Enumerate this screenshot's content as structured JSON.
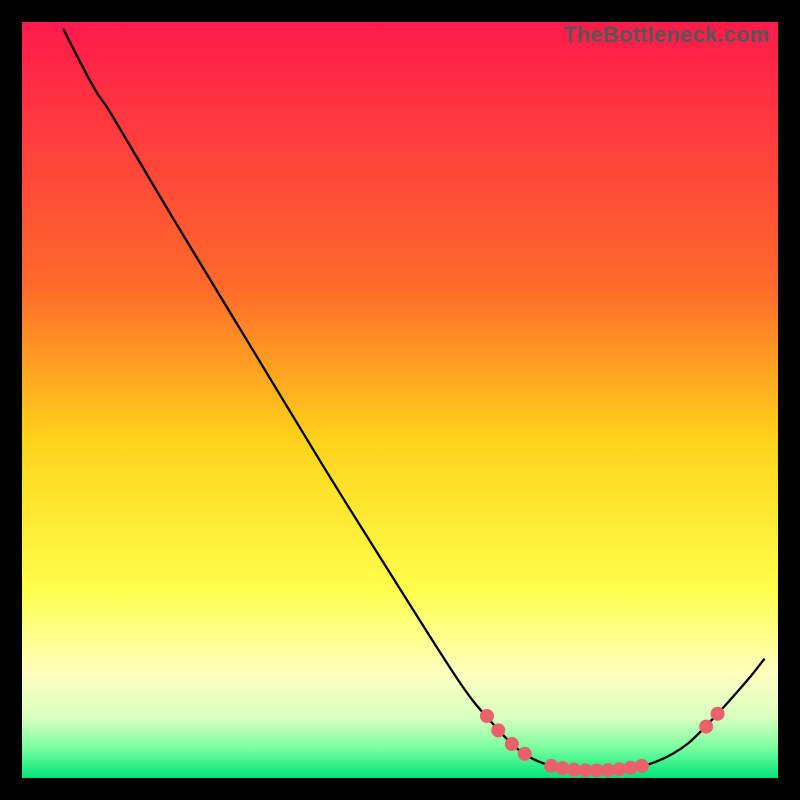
{
  "watermark": "TheBottleneck.com",
  "chart_data": {
    "type": "line",
    "title": "",
    "xlabel": "",
    "ylabel": "",
    "xlim": [
      0,
      100
    ],
    "ylim": [
      0,
      100
    ],
    "gradient_stops": [
      {
        "offset": 0,
        "color": "#ff1a4b"
      },
      {
        "offset": 35,
        "color": "#ff6a2a"
      },
      {
        "offset": 55,
        "color": "#ffd21a"
      },
      {
        "offset": 75,
        "color": "#ffff4a"
      },
      {
        "offset": 86,
        "color": "#ffffbe"
      },
      {
        "offset": 92,
        "color": "#d9ffc0"
      },
      {
        "offset": 96,
        "color": "#7affa0"
      },
      {
        "offset": 100,
        "color": "#00e676"
      }
    ],
    "series": [
      {
        "name": "bottleneck-curve",
        "stroke": "#000000",
        "stroke_width": 2.3,
        "points": [
          {
            "x": 5.5,
            "y": 99.0
          },
          {
            "x": 8.0,
            "y": 94.0
          },
          {
            "x": 10.0,
            "y": 90.5
          },
          {
            "x": 12.0,
            "y": 87.5
          },
          {
            "x": 20.0,
            "y": 74.0
          },
          {
            "x": 30.0,
            "y": 57.5
          },
          {
            "x": 40.0,
            "y": 41.0
          },
          {
            "x": 50.0,
            "y": 25.0
          },
          {
            "x": 58.0,
            "y": 12.5
          },
          {
            "x": 62.0,
            "y": 7.5
          },
          {
            "x": 66.0,
            "y": 3.5
          },
          {
            "x": 70.0,
            "y": 1.6
          },
          {
            "x": 75.0,
            "y": 1.0
          },
          {
            "x": 80.0,
            "y": 1.2
          },
          {
            "x": 84.0,
            "y": 2.2
          },
          {
            "x": 88.0,
            "y": 4.5
          },
          {
            "x": 92.0,
            "y": 8.5
          },
          {
            "x": 96.0,
            "y": 13.0
          },
          {
            "x": 98.0,
            "y": 15.5
          }
        ]
      }
    ],
    "markers": {
      "color": "#e9626b",
      "radius": 7,
      "points": [
        {
          "x": 61.5,
          "y": 8.2
        },
        {
          "x": 63.0,
          "y": 6.3
        },
        {
          "x": 64.8,
          "y": 4.5
        },
        {
          "x": 66.5,
          "y": 3.2
        },
        {
          "x": 70.0,
          "y": 1.6
        },
        {
          "x": 71.5,
          "y": 1.3
        },
        {
          "x": 73.0,
          "y": 1.1
        },
        {
          "x": 74.5,
          "y": 1.0
        },
        {
          "x": 76.0,
          "y": 1.0
        },
        {
          "x": 77.5,
          "y": 1.05
        },
        {
          "x": 79.0,
          "y": 1.15
        },
        {
          "x": 80.5,
          "y": 1.35
        },
        {
          "x": 82.0,
          "y": 1.6
        },
        {
          "x": 90.5,
          "y": 6.8
        },
        {
          "x": 92.0,
          "y": 8.5
        }
      ]
    }
  }
}
